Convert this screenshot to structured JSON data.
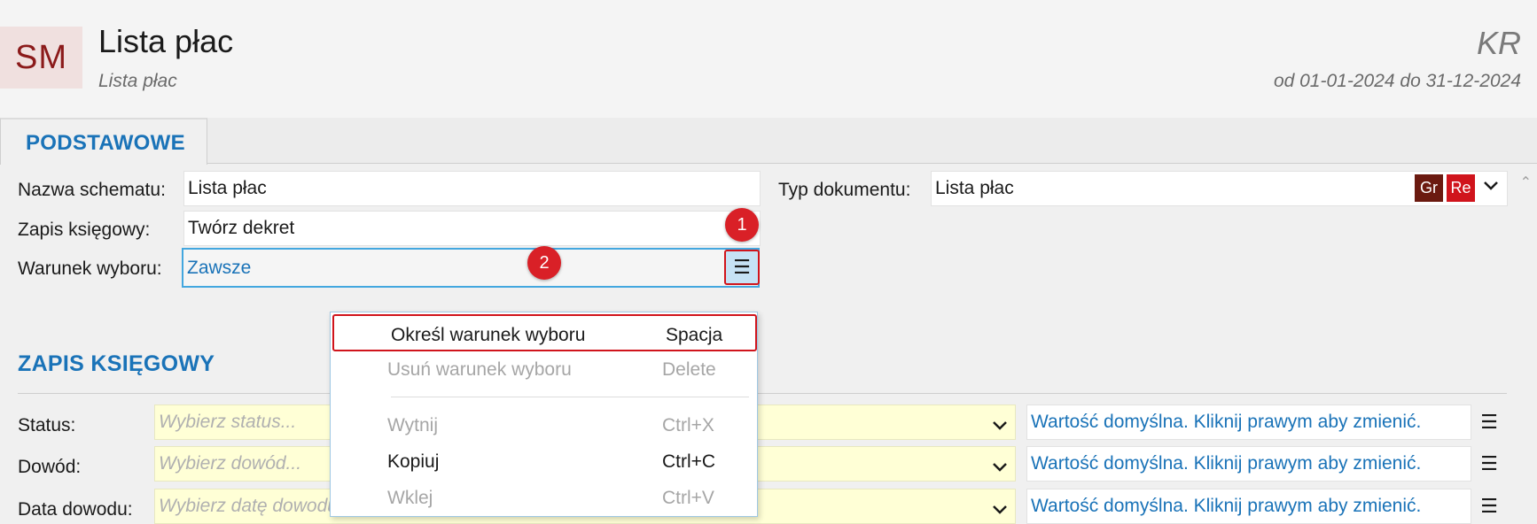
{
  "header": {
    "logo": "SM",
    "title": "Lista płac",
    "subtitle": "Lista płac",
    "company": "KR",
    "period": "od 01-01-2024 do 31-12-2024"
  },
  "tabs": [
    {
      "label": "PODSTAWOWE"
    }
  ],
  "form": {
    "nazwa_label": "Nazwa schematu:",
    "nazwa_value": "Lista płac",
    "typ_label": "Typ dokumentu:",
    "typ_value": "Lista płac",
    "badge_gr": "Gr",
    "badge_re": "Re",
    "zapis_label": "Zapis księgowy:",
    "zapis_value": "Twórz dekret",
    "warunek_label": "Warunek wyboru:",
    "warunek_value": "Zawsze"
  },
  "callouts": [
    "1",
    "2"
  ],
  "section": {
    "title": "ZAPIS KSIĘGOWY",
    "rows": [
      {
        "label": "Status:",
        "placeholder": "Wybierz status...",
        "default_text": "Wartość domyślna. Kliknij prawym aby zmienić."
      },
      {
        "label": "Dowód:",
        "placeholder": "Wybierz dowód...",
        "default_text": "Wartość domyślna. Kliknij prawym aby zmienić."
      },
      {
        "label": "Data dowodu:",
        "placeholder": "Wybierz datę dowodu...",
        "default_text": "Wartość domyślna. Kliknij prawym aby zmienić."
      }
    ]
  },
  "context_menu": {
    "items": [
      {
        "label": "Określ warunek wyboru",
        "shortcut": "Spacja"
      },
      {
        "label": "Usuń warunek wyboru",
        "shortcut": "Delete"
      },
      {
        "label": "Wytnij",
        "shortcut": "Ctrl+X"
      },
      {
        "label": "Kopiuj",
        "shortcut": "Ctrl+C"
      },
      {
        "label": "Wklej",
        "shortcut": "Ctrl+V"
      }
    ]
  },
  "icons": {
    "menu": "hamburger-icon",
    "dropdown": "chevron-down-icon",
    "scroll": "chevron-up-icon"
  },
  "colors": {
    "accent": "#1a73b8",
    "highlight_red": "#d0141c",
    "yellow_field": "#ffffd6"
  }
}
